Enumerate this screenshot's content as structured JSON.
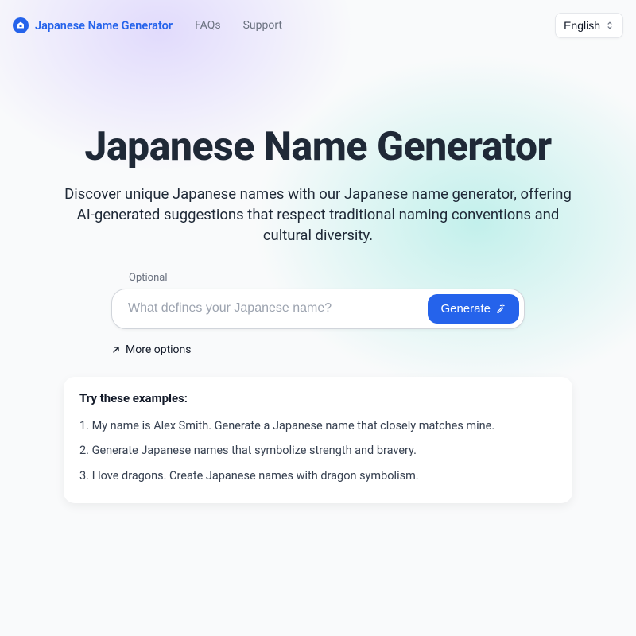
{
  "nav": {
    "brand": "Japanese Name Generator",
    "links": [
      "FAQs",
      "Support"
    ],
    "language": "English"
  },
  "hero": {
    "title": "Japanese Name Generator",
    "subtitle": "Discover unique Japanese names with our Japanese name generator, offering AI-generated suggestions that respect traditional naming conventions and cultural diversity."
  },
  "form": {
    "optional_label": "Optional",
    "placeholder": "What defines your Japanese name?",
    "generate_label": "Generate",
    "more_options": "More options"
  },
  "examples": {
    "title": "Try these examples:",
    "items": [
      "1. My name is Alex Smith. Generate a Japanese name that closely matches mine.",
      "2. Generate Japanese names that symbolize strength and bravery.",
      "3. I love dragons. Create Japanese names with dragon symbolism."
    ]
  }
}
